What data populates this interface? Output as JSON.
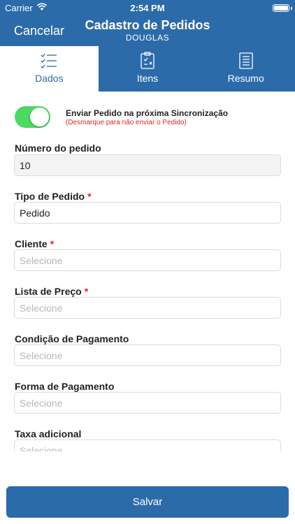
{
  "status": {
    "carrier": "Carrier",
    "time": "2:54 PM"
  },
  "nav": {
    "cancel_label": "Cancelar",
    "title": "Cadastro de Pedidos",
    "subtitle": "DOUGLAS"
  },
  "tabs": [
    {
      "label": "Dados",
      "icon": "checklist-icon",
      "active": true
    },
    {
      "label": "Itens",
      "icon": "clipboard-icon",
      "active": false
    },
    {
      "label": "Resumo",
      "icon": "document-icon",
      "active": false
    }
  ],
  "sync": {
    "enabled": true,
    "title": "Enviar Pedido na próxima Sincronização",
    "hint": "(Desmarque para não enviar o Pedido)"
  },
  "fields": [
    {
      "label": "Número do pedido",
      "required": false,
      "value": "10",
      "placeholder": "",
      "disabled": true
    },
    {
      "label": "Tipo de Pedido",
      "required": true,
      "value": "Pedido",
      "placeholder": ""
    },
    {
      "label": "Cliente",
      "required": true,
      "value": "",
      "placeholder": "Selecione"
    },
    {
      "label": "Lista de Preço",
      "required": true,
      "value": "",
      "placeholder": "Selecione"
    },
    {
      "label": "Condição de Pagamento",
      "required": false,
      "value": "",
      "placeholder": "Selecione"
    },
    {
      "label": "Forma de Pagamento",
      "required": false,
      "value": "",
      "placeholder": "Selecione"
    },
    {
      "label": "Taxa adicional",
      "required": false,
      "value": "",
      "placeholder": "Selecione"
    }
  ],
  "required_marker": "*",
  "save_label": "Salvar",
  "colors": {
    "primary": "#2c6baa",
    "switch_on": "#4cd964",
    "required": "#e0242b"
  }
}
